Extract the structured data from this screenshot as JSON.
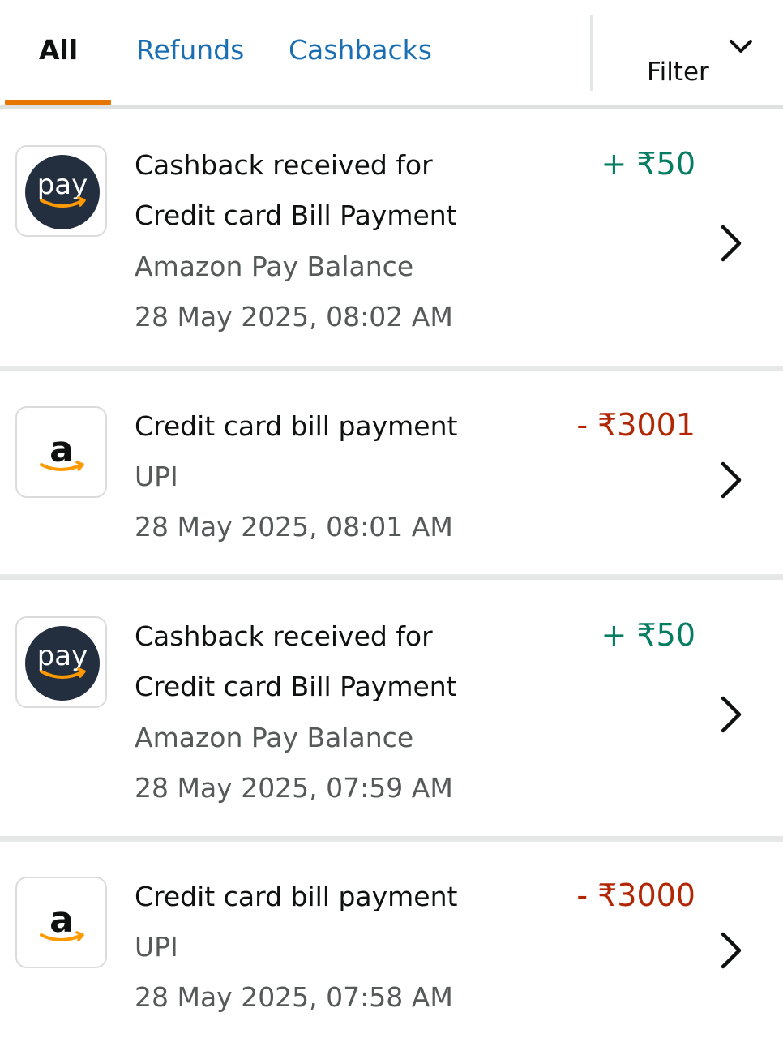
{
  "tabs": {
    "all": "All",
    "refunds": "Refunds",
    "cashbacks": "Cashbacks",
    "filter": "Filter"
  },
  "colors": {
    "active_tab_underline": "#e77600",
    "link_tab": "#1a6fb4",
    "credit_amount": "#067d62",
    "debit_amount": "#b12704"
  },
  "transactions": [
    {
      "icon": "amazon-pay-logo",
      "icon_text": "pay",
      "title_line1": "Cashback received for",
      "title_line2": "Credit card Bill Payment",
      "method": "Amazon Pay Balance",
      "datetime": "28 May 2025, 08:02 AM",
      "amount": "+ ₹50",
      "direction": "credit"
    },
    {
      "icon": "amazon-logo",
      "icon_text": "a",
      "title_line1": "Credit card bill payment",
      "method": "UPI",
      "datetime": "28 May 2025, 08:01 AM",
      "amount": "- ₹3001",
      "direction": "debit"
    },
    {
      "icon": "amazon-pay-logo",
      "icon_text": "pay",
      "title_line1": "Cashback received for",
      "title_line2": "Credit card Bill Payment",
      "method": "Amazon Pay Balance",
      "datetime": "28 May 2025, 07:59 AM",
      "amount": "+ ₹50",
      "direction": "credit"
    },
    {
      "icon": "amazon-logo",
      "icon_text": "a",
      "title_line1": "Credit card bill payment",
      "method": "UPI",
      "datetime": "28 May 2025, 07:58 AM",
      "amount": "- ₹3000",
      "direction": "debit"
    }
  ]
}
